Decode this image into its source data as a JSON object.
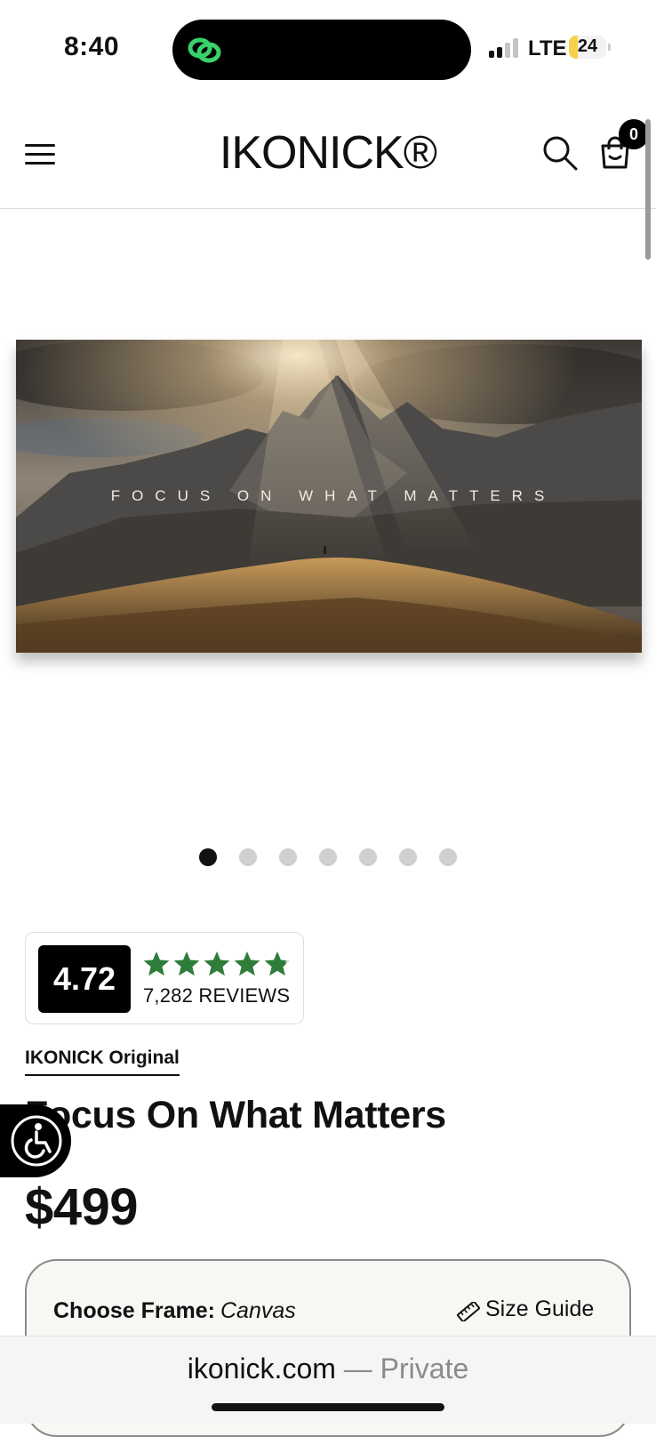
{
  "status_bar": {
    "time": "8:40",
    "network": "LTE",
    "battery": "24",
    "battery_level": 0.24,
    "icons": [
      "signal-icon",
      "battery-icon",
      "link-activity-icon"
    ]
  },
  "header": {
    "brand": "IKONICK®",
    "cart_count": "0",
    "icons": [
      "menu-icon",
      "search-icon",
      "cart-icon"
    ]
  },
  "hero": {
    "image_text": "FOCUS ON WHAT MATTERS",
    "slide_count": 7,
    "active_slide": 1
  },
  "rating": {
    "score": "4.72",
    "stars": 4.72,
    "reviews": "7,282 REVIEWS",
    "star_color": "#2e7d3a"
  },
  "product": {
    "collection_link": "IKONICK Original",
    "title": "Focus On What Matters",
    "price": "$499"
  },
  "frame": {
    "label": "Choose Frame:",
    "value": "Canvas",
    "size_guide": "Size Guide"
  },
  "browser": {
    "domain": "ikonick.com",
    "mode": "— Private"
  }
}
